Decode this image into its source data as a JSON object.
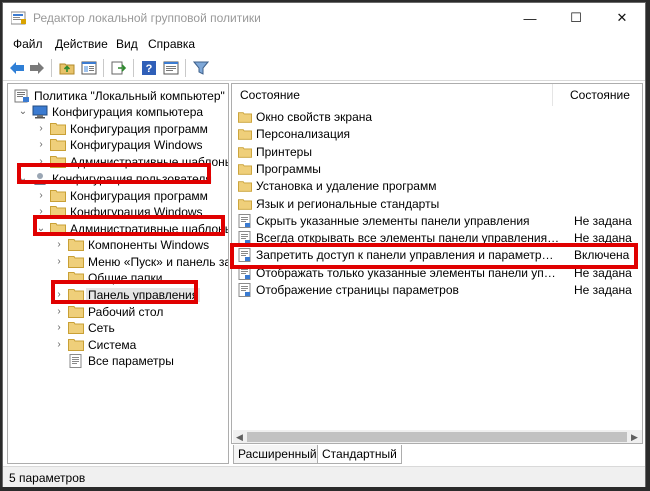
{
  "window": {
    "title": "Редактор локальной групповой политики",
    "minimize_glyph": "—",
    "maximize_glyph": "☐",
    "close_glyph": "✕"
  },
  "menu": [
    "Файл",
    "Действие",
    "Вид",
    "Справка"
  ],
  "toolbar": {
    "icons": [
      "back-arrow-icon",
      "forward-arrow-icon",
      "up-folder-icon",
      "show-hide-tree-icon",
      "export-list-icon",
      "help-icon",
      "properties-icon",
      "filter-icon"
    ]
  },
  "tree": {
    "root": "Политика \"Локальный компьютер\"",
    "computer_config": "Конфигурация компьютера",
    "cc_software": "Конфигурация программ",
    "cc_windows": "Конфигурация Windows",
    "cc_admin": "Административные шаблоны",
    "user_config": "Конфигурация пользователя",
    "uc_software": "Конфигурация программ",
    "uc_windows": "Конфигурация Windows",
    "uc_admin": "Административные шаблоны",
    "win_components": "Компоненты Windows",
    "start_menu": "Меню «Пуск» и панель задач",
    "shared_folders": "Общие папки",
    "control_panel": "Панель управления",
    "desktop": "Рабочий стол",
    "network": "Сеть",
    "system": "Система",
    "all_settings": "Все параметры"
  },
  "list": {
    "col_setting": "Состояние",
    "col_state": "Состояние",
    "rows": [
      {
        "label": "Окно свойств экрана",
        "state": "",
        "kind": "folder"
      },
      {
        "label": "Персонализация",
        "state": "",
        "kind": "folder"
      },
      {
        "label": "Принтеры",
        "state": "",
        "kind": "folder"
      },
      {
        "label": "Программы",
        "state": "",
        "kind": "folder"
      },
      {
        "label": "Установка и удаление программ",
        "state": "",
        "kind": "folder"
      },
      {
        "label": "Язык и региональные стандарты",
        "state": "",
        "kind": "folder"
      },
      {
        "label": "Скрыть указанные элементы панели управления",
        "state": "Не задана",
        "kind": "policy"
      },
      {
        "label": "Всегда открывать все элементы панели управления при...",
        "state": "Не задана",
        "kind": "policy"
      },
      {
        "label": "Запретить доступ к панели управления и параметрам ко...",
        "state": "Включена",
        "kind": "policy"
      },
      {
        "label": "Отображать только указанные элементы панели управления",
        "state": "Не задана",
        "kind": "policy"
      },
      {
        "label": "Отображение страницы параметров",
        "state": "Не задана",
        "kind": "policy"
      }
    ]
  },
  "tabs": {
    "extended": "Расширенный",
    "standard": "Стандартный"
  },
  "status": "5 параметров",
  "colors": {
    "highlight": "#e00000",
    "folder": "#e8c36a",
    "selection": "#e5e5e5"
  }
}
